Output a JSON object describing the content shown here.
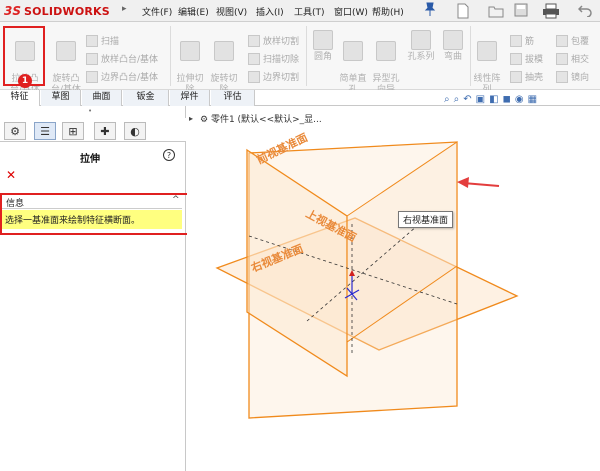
{
  "app": {
    "logo_prefix": "3S",
    "logo_name": "SOLIDWORKS",
    "logo_arrow": "▸"
  },
  "menu": [
    "文件(F)",
    "编辑(E)",
    "视图(V)",
    "插入(I)",
    "工具(T)",
    "窗口(W)",
    "帮助(H)"
  ],
  "quick_access": [
    "new-file-icon",
    "open-file-icon",
    "save-icon",
    "print-icon",
    "undo-icon"
  ],
  "ribbon": {
    "extrude_boss": "拉伸凸\n台/基体",
    "revolve_boss": "旋转凸\n台/基体",
    "sweep": "扫描",
    "loft_boss": "放样凸台/基体",
    "boundary_boss": "边界凸台/基体",
    "extrude_cut": "拉伸切\n除",
    "revolve_cut": "旋转切\n除",
    "loft_cut": "放样切割",
    "sweep_cut": "扫描切除",
    "boundary_cut": "边界切割",
    "fillet": "圆角",
    "simple_hole": "简单直\n孔",
    "hole_wizard": "异型孔\n向导",
    "hole_series": "孔系列",
    "curve": "弯曲",
    "linear_pattern": "线性阵\n列",
    "rib": "筋",
    "draft": "拔模",
    "shell": "抽壳",
    "wrap": "包覆",
    "intersect": "相交",
    "mirror": "镜向"
  },
  "badge": "1",
  "tabs": [
    "特征",
    "草图",
    "曲面",
    "钣金",
    "焊件",
    "评估"
  ],
  "panel": {
    "title": "拉伸",
    "help": "?",
    "cancel": "✕",
    "info_header": "信息",
    "info_collapse": "^",
    "info_text": "选择一基准面来绘制特征横断面。"
  },
  "viewport": {
    "breadcrumb": "零件1  (默认<<默认>_显...",
    "tooltip": "右视基准面",
    "planes": {
      "front": "前视基准面",
      "top": "上视基准面",
      "right": "右视基准面"
    },
    "colors": {
      "plane_stroke": "#f08a1c",
      "plane_fill": "#fde6cc",
      "arrow": "#e33d3d"
    }
  },
  "colors": {
    "highlight": "#e02020",
    "info_bg": "#ffff80",
    "accent_blue": "#2a5aa8"
  }
}
